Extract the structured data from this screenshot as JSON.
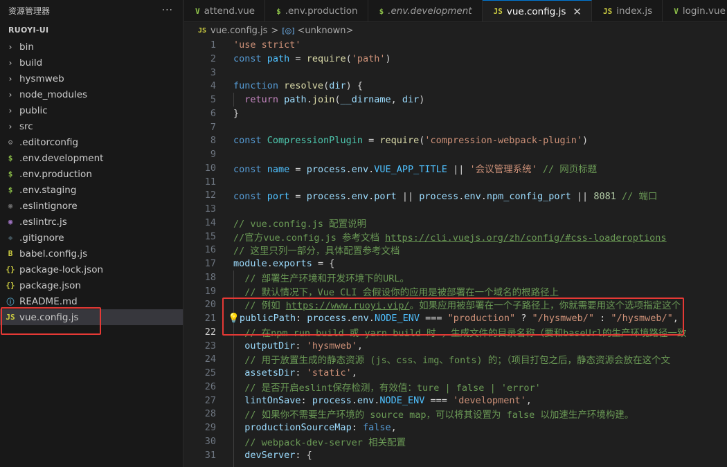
{
  "sidebar": {
    "header": "资源管理器",
    "more": "···",
    "project": "RUOYI-UI",
    "items": [
      {
        "label": "bin",
        "kind": "folder"
      },
      {
        "label": "build",
        "kind": "folder"
      },
      {
        "label": "hysmweb",
        "kind": "folder"
      },
      {
        "label": "node_modules",
        "kind": "folder"
      },
      {
        "label": "public",
        "kind": "folder"
      },
      {
        "label": "src",
        "kind": "folder"
      },
      {
        "label": ".editorconfig",
        "kind": "file",
        "icon": "⚙",
        "color": "#8a8a8a"
      },
      {
        "label": ".env.development",
        "kind": "file",
        "icon": "$",
        "color": "#8dc149"
      },
      {
        "label": ".env.production",
        "kind": "file",
        "icon": "$",
        "color": "#8dc149"
      },
      {
        "label": ".env.staging",
        "kind": "file",
        "icon": "$",
        "color": "#8dc149"
      },
      {
        "label": ".eslintignore",
        "kind": "file",
        "icon": "◉",
        "color": "#6d6d6d"
      },
      {
        "label": ".eslintrc.js",
        "kind": "file",
        "icon": "◉",
        "color": "#a074c4"
      },
      {
        "label": ".gitignore",
        "kind": "file",
        "icon": "◆",
        "color": "#41535b"
      },
      {
        "label": "babel.config.js",
        "kind": "file",
        "icon": "B",
        "color": "#cbcb41"
      },
      {
        "label": "package-lock.json",
        "kind": "file",
        "icon": "{}",
        "color": "#cbcb41"
      },
      {
        "label": "package.json",
        "kind": "file",
        "icon": "{}",
        "color": "#cbcb41"
      },
      {
        "label": "README.md",
        "kind": "file",
        "icon": "ⓘ",
        "color": "#519aba"
      },
      {
        "label": "vue.config.js",
        "kind": "file",
        "icon": "JS",
        "color": "#cbcb41",
        "selected": true
      }
    ]
  },
  "tabs": [
    {
      "label": "attend.vue",
      "icon": "V",
      "color": "#8dc149"
    },
    {
      "label": ".env.production",
      "icon": "$",
      "color": "#8dc149"
    },
    {
      "label": ".env.development",
      "icon": "$",
      "color": "#8dc149",
      "italic": true
    },
    {
      "label": "vue.config.js",
      "icon": "JS",
      "color": "#cbcb41",
      "active": true,
      "close": "✕"
    },
    {
      "label": "index.js",
      "icon": "JS",
      "color": "#cbcb41"
    },
    {
      "label": "login.vue",
      "icon": "V",
      "color": "#8dc149"
    }
  ],
  "breadcrumb": {
    "file": "vue.config.js",
    "file_icon": "JS",
    "separator": ">",
    "symbol_icon": "[◎]",
    "symbol": "<unknown>"
  },
  "editor": {
    "current_line": 22,
    "lines": [
      {
        "n": 1,
        "t": [
          [
            "t-str",
            "'use strict'"
          ]
        ]
      },
      {
        "n": 2,
        "t": [
          [
            "t-kw",
            "const "
          ],
          [
            "t-const",
            "path"
          ],
          [
            "t-plain",
            " = "
          ],
          [
            "t-fn",
            "require"
          ],
          [
            "t-plain",
            "("
          ],
          [
            "t-str",
            "'path'"
          ],
          [
            "t-plain",
            ")"
          ]
        ]
      },
      {
        "n": 3,
        "t": []
      },
      {
        "n": 4,
        "t": [
          [
            "t-kw",
            "function "
          ],
          [
            "t-fn",
            "resolve"
          ],
          [
            "t-plain",
            "("
          ],
          [
            "t-var",
            "dir"
          ],
          [
            "t-plain",
            ") {"
          ]
        ]
      },
      {
        "n": 5,
        "t": [
          [
            "t-plain",
            "  "
          ],
          [
            "t-ctl",
            "return "
          ],
          [
            "t-var",
            "path"
          ],
          [
            "t-plain",
            "."
          ],
          [
            "t-fn",
            "join"
          ],
          [
            "t-plain",
            "("
          ],
          [
            "t-var",
            "__dirname"
          ],
          [
            "t-plain",
            ", "
          ],
          [
            "t-var",
            "dir"
          ],
          [
            "t-plain",
            ")"
          ]
        ]
      },
      {
        "n": 6,
        "t": [
          [
            "t-plain",
            "}"
          ]
        ]
      },
      {
        "n": 7,
        "t": []
      },
      {
        "n": 8,
        "t": [
          [
            "t-kw",
            "const "
          ],
          [
            "t-cls",
            "CompressionPlugin"
          ],
          [
            "t-plain",
            " = "
          ],
          [
            "t-fn",
            "require"
          ],
          [
            "t-plain",
            "("
          ],
          [
            "t-str",
            "'compression-webpack-plugin'"
          ],
          [
            "t-plain",
            ")"
          ]
        ]
      },
      {
        "n": 9,
        "t": []
      },
      {
        "n": 10,
        "t": [
          [
            "t-kw",
            "const "
          ],
          [
            "t-const",
            "name"
          ],
          [
            "t-plain",
            " = "
          ],
          [
            "t-var",
            "process"
          ],
          [
            "t-plain",
            "."
          ],
          [
            "t-var",
            "env"
          ],
          [
            "t-plain",
            "."
          ],
          [
            "t-const",
            "VUE_APP_TITLE"
          ],
          [
            "t-plain",
            " || "
          ],
          [
            "t-str",
            "'会议管理系统'"
          ],
          [
            "t-cmt",
            " // 网页标题"
          ]
        ]
      },
      {
        "n": 11,
        "t": []
      },
      {
        "n": 12,
        "t": [
          [
            "t-kw",
            "const "
          ],
          [
            "t-const",
            "port"
          ],
          [
            "t-plain",
            " = "
          ],
          [
            "t-var",
            "process"
          ],
          [
            "t-plain",
            "."
          ],
          [
            "t-var",
            "env"
          ],
          [
            "t-plain",
            "."
          ],
          [
            "t-var",
            "port"
          ],
          [
            "t-plain",
            " || "
          ],
          [
            "t-var",
            "process"
          ],
          [
            "t-plain",
            "."
          ],
          [
            "t-var",
            "env"
          ],
          [
            "t-plain",
            "."
          ],
          [
            "t-var",
            "npm_config_port"
          ],
          [
            "t-plain",
            " || "
          ],
          [
            "t-num",
            "8081"
          ],
          [
            "t-cmt",
            " // 端口"
          ]
        ]
      },
      {
        "n": 13,
        "t": []
      },
      {
        "n": 14,
        "t": [
          [
            "t-cmt",
            "// vue.config.js 配置说明"
          ]
        ]
      },
      {
        "n": 15,
        "t": [
          [
            "t-cmt",
            "//官方vue.config.js 参考文档 "
          ],
          [
            "t-url",
            "https://cli.vuejs.org/zh/config/#css-loaderoptions"
          ]
        ]
      },
      {
        "n": 16,
        "t": [
          [
            "t-cmt",
            "// 这里只列一部分，具体配置参考文档"
          ]
        ]
      },
      {
        "n": 17,
        "t": [
          [
            "t-var",
            "module"
          ],
          [
            "t-plain",
            "."
          ],
          [
            "t-var",
            "exports"
          ],
          [
            "t-plain",
            " = {"
          ]
        ]
      },
      {
        "n": 18,
        "t": [
          [
            "t-cmt",
            "  // 部署生产环境和开发环境下的URL。"
          ]
        ]
      },
      {
        "n": 19,
        "t": [
          [
            "t-cmt",
            "  // 默认情况下，Vue CLI 会假设你的应用是被部署在一个域名的根路径上"
          ]
        ]
      },
      {
        "n": 20,
        "t": [
          [
            "t-cmt",
            "  // 例如 "
          ],
          [
            "t-url",
            "https://www.ruoyi.vip/"
          ],
          [
            "t-cmt",
            "。如果应用被部署在一个子路径上，你就需要用这个选项指定这个"
          ]
        ]
      },
      {
        "n": 21,
        "bulb": "💡",
        "t": [
          [
            "t-var",
            "publicPath"
          ],
          [
            "t-plain",
            ": "
          ],
          [
            "t-var",
            "process"
          ],
          [
            "t-plain",
            "."
          ],
          [
            "t-var",
            "env"
          ],
          [
            "t-plain",
            "."
          ],
          [
            "t-const",
            "NODE_ENV"
          ],
          [
            "t-plain",
            " === "
          ],
          [
            "t-str",
            "\"production\""
          ],
          [
            "t-plain",
            " ? "
          ],
          [
            "t-str",
            "\"/hysmweb/\""
          ],
          [
            "t-plain",
            " : "
          ],
          [
            "t-str",
            "\"/hysmweb/\""
          ],
          [
            "t-plain",
            ","
          ]
        ]
      },
      {
        "n": 22,
        "t": [
          [
            "t-cmt",
            "  // 在npm run build 或 yarn build 时 ，生成文件的目录名称（要和baseUrl的生产环境路径一致"
          ]
        ]
      },
      {
        "n": 23,
        "t": [
          [
            "t-plain",
            "  "
          ],
          [
            "t-var",
            "outputDir"
          ],
          [
            "t-plain",
            ": "
          ],
          [
            "t-str",
            "'hysmweb'"
          ],
          [
            "t-plain",
            ","
          ]
        ]
      },
      {
        "n": 24,
        "t": [
          [
            "t-cmt",
            "  // 用于放置生成的静态资源 (js、css、img、fonts) 的；（项目打包之后，静态资源会放在这个文"
          ]
        ]
      },
      {
        "n": 25,
        "t": [
          [
            "t-plain",
            "  "
          ],
          [
            "t-var",
            "assetsDir"
          ],
          [
            "t-plain",
            ": "
          ],
          [
            "t-str",
            "'static'"
          ],
          [
            "t-plain",
            ","
          ]
        ]
      },
      {
        "n": 26,
        "t": [
          [
            "t-cmt",
            "  // 是否开启eslint保存检测，有效值：ture | false | 'error'"
          ]
        ]
      },
      {
        "n": 27,
        "t": [
          [
            "t-plain",
            "  "
          ],
          [
            "t-var",
            "lintOnSave"
          ],
          [
            "t-plain",
            ": "
          ],
          [
            "t-var",
            "process"
          ],
          [
            "t-plain",
            "."
          ],
          [
            "t-var",
            "env"
          ],
          [
            "t-plain",
            "."
          ],
          [
            "t-const",
            "NODE_ENV"
          ],
          [
            "t-plain",
            " === "
          ],
          [
            "t-str",
            "'development'"
          ],
          [
            "t-plain",
            ","
          ]
        ]
      },
      {
        "n": 28,
        "t": [
          [
            "t-cmt",
            "  // 如果你不需要生产环境的 source map，可以将其设置为 false 以加速生产环境构建。"
          ]
        ]
      },
      {
        "n": 29,
        "t": [
          [
            "t-plain",
            "  "
          ],
          [
            "t-var",
            "productionSourceMap"
          ],
          [
            "t-plain",
            ": "
          ],
          [
            "t-kw",
            "false"
          ],
          [
            "t-plain",
            ","
          ]
        ]
      },
      {
        "n": 30,
        "t": [
          [
            "t-cmt",
            "  // webpack-dev-server 相关配置"
          ]
        ]
      },
      {
        "n": 31,
        "t": [
          [
            "t-plain",
            "  "
          ],
          [
            "t-var",
            "devServer"
          ],
          [
            "t-plain",
            ": {"
          ]
        ]
      }
    ]
  }
}
